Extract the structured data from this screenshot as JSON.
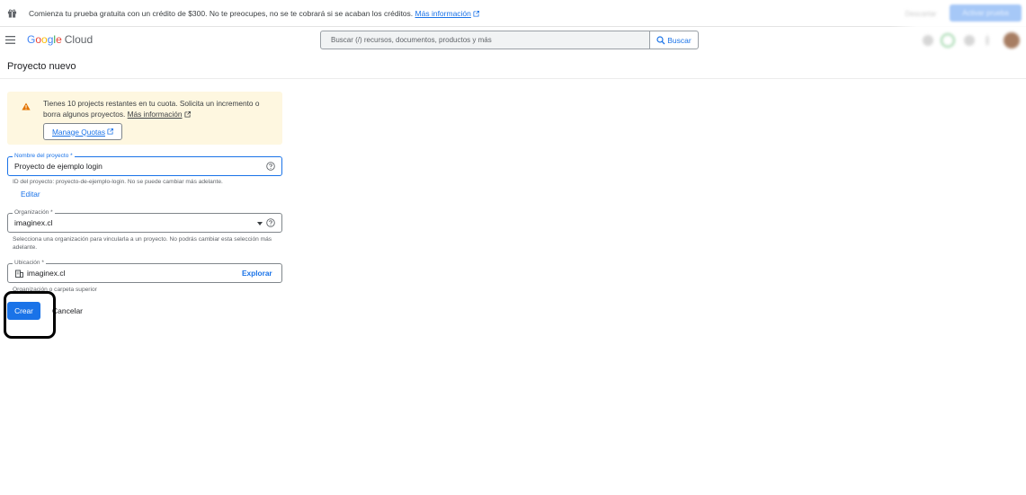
{
  "promo": {
    "text": "Comienza tu prueba gratuita con un crédito de $300. No te preocupes, no se te cobrará si se acaban los créditos.",
    "link": "Más información",
    "dismiss_label": "Descartar",
    "activate_label": "Activar prueba",
    "icons": [
      "gift-icon",
      "external-link-icon"
    ]
  },
  "header": {
    "logo": {
      "g1": "G",
      "o1": "o",
      "o2": "o",
      "g2": "g",
      "l": "l",
      "e": "e",
      "cloud": "Cloud"
    },
    "search_placeholder": "Buscar (/) recursos, documentos, productos y más",
    "search_button": "Buscar",
    "icons": [
      "menu-icon",
      "search-icon",
      "gift-icon",
      "cloud-shell-icon",
      "notifications-icon",
      "help-icon",
      "more-icon",
      "avatar"
    ]
  },
  "page": {
    "title": "Proyecto nuevo"
  },
  "warning": {
    "text": "Tienes 10 projects restantes en tu cuota. Solicita un incremento o borra algunos proyectos.",
    "link": "Más información",
    "button": "Manage Quotas"
  },
  "form": {
    "project_name": {
      "label": "Nombre del proyecto *",
      "value": "Proyecto de ejemplo login",
      "hint": "ID del proyecto: proyecto-de-ejemplo-login. No se puede cambiar más adelante.",
      "edit_link": "Editar"
    },
    "organization": {
      "label": "Organización *",
      "value": "imaginex.cl",
      "hint": "Selecciona una organización para vincularla a un proyecto. No podrás cambiar esta selección más adelante."
    },
    "location": {
      "label": "Ubicación *",
      "value": "imaginex.cl",
      "browse": "Explorar",
      "hint": "Organización o carpeta superior"
    },
    "create_button": "Crear",
    "cancel_button": "Cancelar"
  },
  "colors": {
    "accent": "#1a73e8",
    "warning_bg": "#fef7e0",
    "warning_icon": "#e37400"
  }
}
